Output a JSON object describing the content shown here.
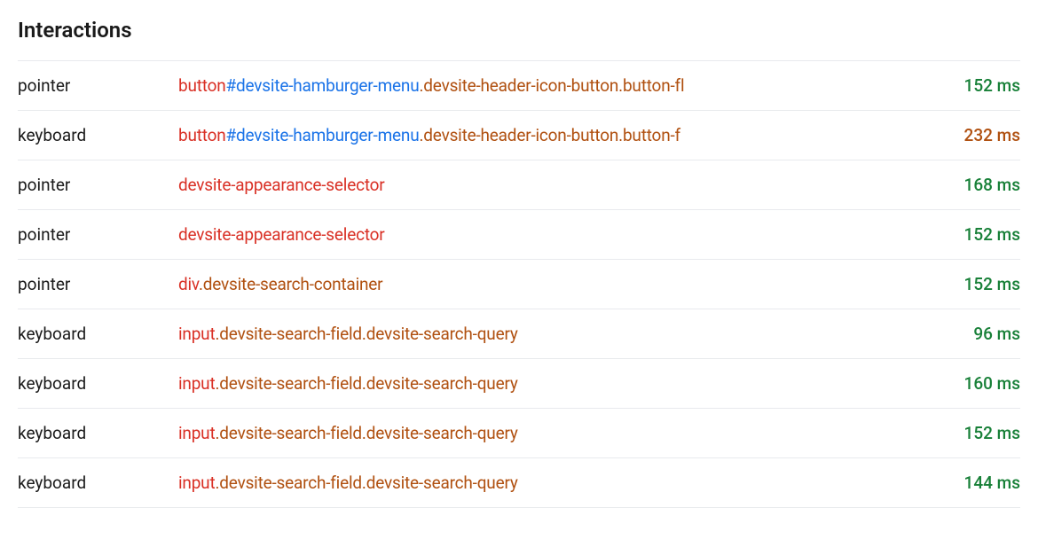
{
  "title": "Interactions",
  "interactions": [
    {
      "type": "pointer",
      "selector": [
        {
          "kind": "tag",
          "text": "button"
        },
        {
          "kind": "id",
          "text": "#devsite-hamburger-menu"
        },
        {
          "kind": "class",
          "text": ".devsite-header-icon-button"
        },
        {
          "kind": "class",
          "text": ".button-fl"
        }
      ],
      "duration": "152 ms",
      "duration_class": "green"
    },
    {
      "type": "keyboard",
      "selector": [
        {
          "kind": "tag",
          "text": "button"
        },
        {
          "kind": "id",
          "text": "#devsite-hamburger-menu"
        },
        {
          "kind": "class",
          "text": ".devsite-header-icon-button"
        },
        {
          "kind": "class",
          "text": ".button-f"
        }
      ],
      "duration": "232 ms",
      "duration_class": "orange"
    },
    {
      "type": "pointer",
      "selector": [
        {
          "kind": "tag",
          "text": "devsite-appearance-selector"
        }
      ],
      "duration": "168 ms",
      "duration_class": "green"
    },
    {
      "type": "pointer",
      "selector": [
        {
          "kind": "tag",
          "text": "devsite-appearance-selector"
        }
      ],
      "duration": "152 ms",
      "duration_class": "green"
    },
    {
      "type": "pointer",
      "selector": [
        {
          "kind": "tag",
          "text": "div"
        },
        {
          "kind": "class",
          "text": ".devsite-search-container"
        }
      ],
      "duration": "152 ms",
      "duration_class": "green"
    },
    {
      "type": "keyboard",
      "selector": [
        {
          "kind": "tag",
          "text": "input"
        },
        {
          "kind": "class",
          "text": ".devsite-search-field"
        },
        {
          "kind": "class",
          "text": ".devsite-search-query"
        }
      ],
      "duration": "96 ms",
      "duration_class": "green"
    },
    {
      "type": "keyboard",
      "selector": [
        {
          "kind": "tag",
          "text": "input"
        },
        {
          "kind": "class",
          "text": ".devsite-search-field"
        },
        {
          "kind": "class",
          "text": ".devsite-search-query"
        }
      ],
      "duration": "160 ms",
      "duration_class": "green"
    },
    {
      "type": "keyboard",
      "selector": [
        {
          "kind": "tag",
          "text": "input"
        },
        {
          "kind": "class",
          "text": ".devsite-search-field"
        },
        {
          "kind": "class",
          "text": ".devsite-search-query"
        }
      ],
      "duration": "152 ms",
      "duration_class": "green"
    },
    {
      "type": "keyboard",
      "selector": [
        {
          "kind": "tag",
          "text": "input"
        },
        {
          "kind": "class",
          "text": ".devsite-search-field"
        },
        {
          "kind": "class",
          "text": ".devsite-search-query"
        }
      ],
      "duration": "144 ms",
      "duration_class": "green"
    }
  ]
}
